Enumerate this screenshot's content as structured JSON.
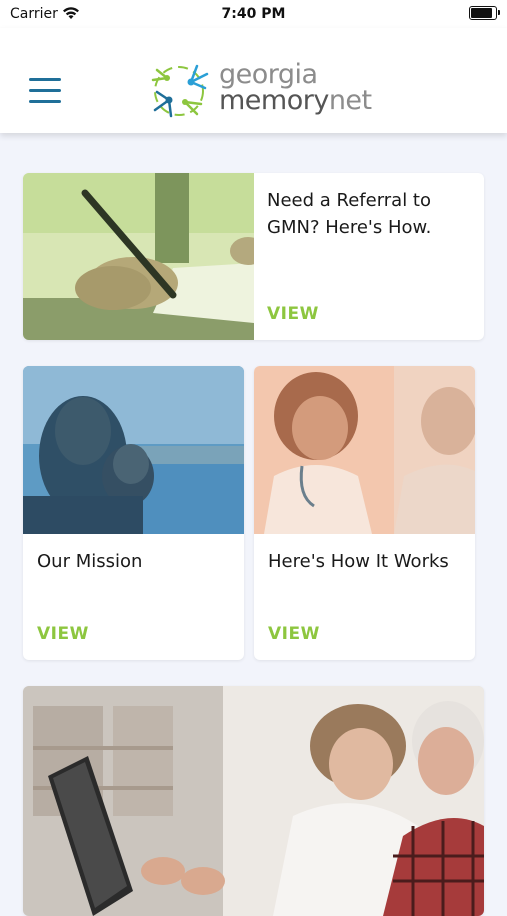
{
  "status_bar": {
    "carrier": "Carrier",
    "time": "7:40 PM"
  },
  "header": {
    "logo_line1": "georgia",
    "logo_line2_a": "memory",
    "logo_line2_b": "net",
    "menu_icon": "hamburger-menu-icon"
  },
  "cards": [
    {
      "title_line1": "Need a Referral to",
      "title_line2": "GMN? Here's How.",
      "action": "VIEW",
      "image": "signing-document-photo"
    },
    {
      "title": "Our Mission",
      "action": "VIEW",
      "image": "couple-smiling-photo"
    },
    {
      "title": "Here's How It Works",
      "action": "VIEW",
      "image": "doctor-with-patient-photo"
    },
    {
      "image": "couple-with-laptop-photo"
    }
  ],
  "colors": {
    "accent_green": "#8dc63f",
    "menu_blue": "#1f6f99",
    "background": "#f2f4fb"
  }
}
